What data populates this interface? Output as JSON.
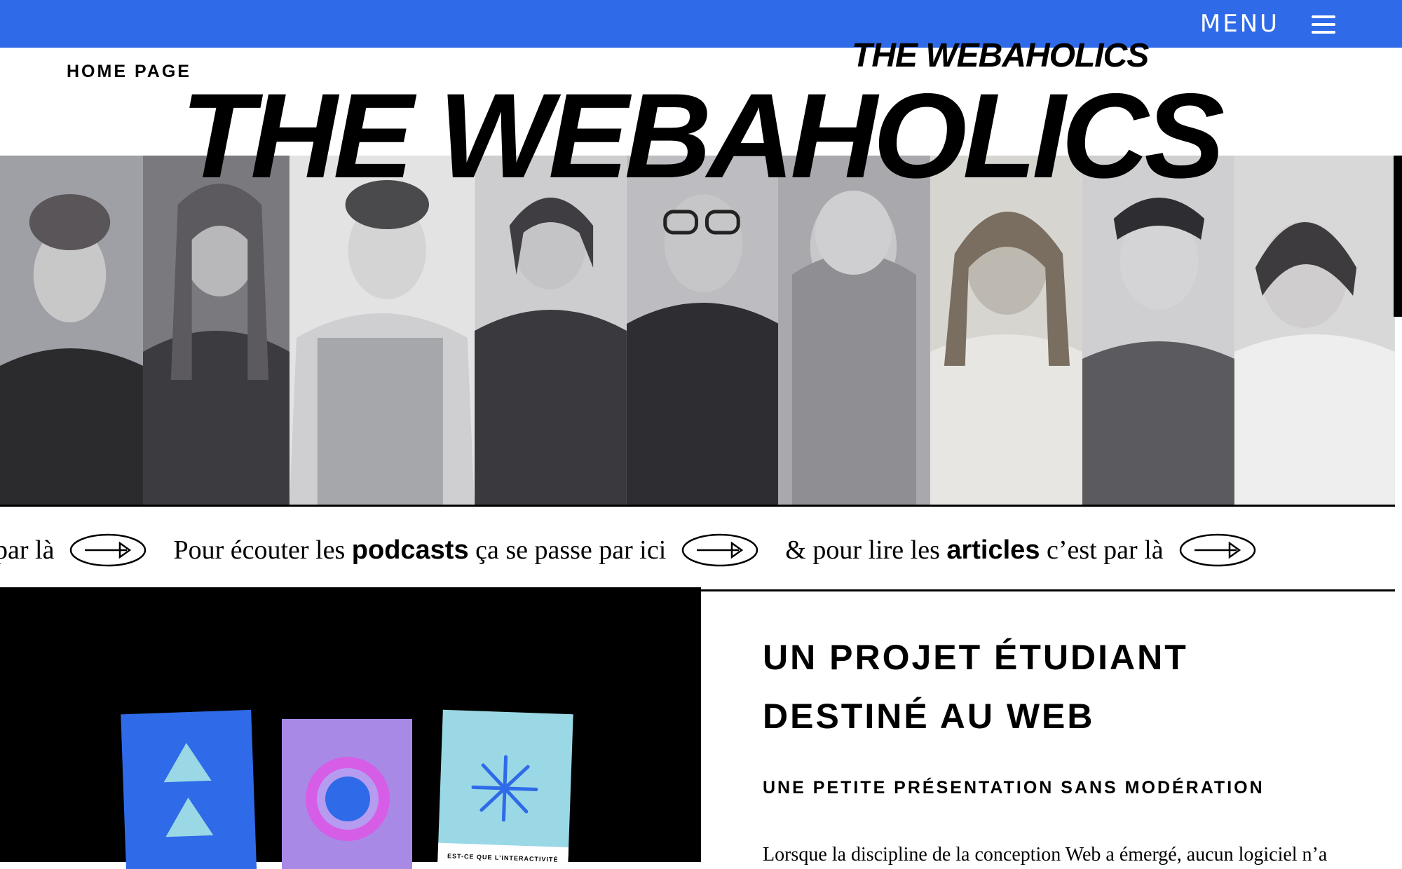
{
  "header": {
    "menu_label": "MENU",
    "home_label": "HOME PAGE",
    "brand_small": "THE WEBAHOLICS",
    "brand_large": "THE WEBAHOLICS",
    "bar_color": "#2f6ae8"
  },
  "ticker": {
    "segment0_rest": "par là",
    "segment1_pre": "Pour écouter les ",
    "segment1_bold": "podcasts",
    "segment1_post": " ça se passe par ici",
    "segment2_pre": "& pour lire les ",
    "segment2_bold": "articles",
    "segment2_post": " c’est par là",
    "arrow_icon": "arrow-right-icon"
  },
  "cards": {
    "card3_caption": "EST-CE QUE L’INTERACTIVITÉ"
  },
  "intro": {
    "title_line1": "UN PROJET ÉTUDIANT",
    "title_line2": "DESTINÉ AU WEB",
    "subtitle": "UNE PETITE PRÉSENTATION SANS MODÉRATION",
    "body_start": "Lorsque la discipline de la conception Web a émergé, aucun logiciel n’a"
  }
}
